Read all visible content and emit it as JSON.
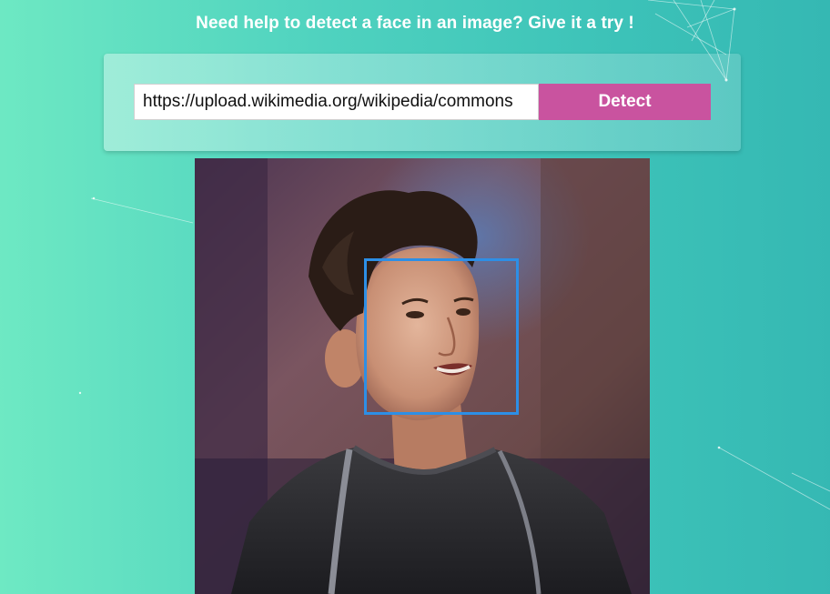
{
  "header": {
    "title": "Need help to detect a face in an image? Give it a try !"
  },
  "form": {
    "url_value": "https://upload.wikimedia.org/wikipedia/commons",
    "detect_label": "Detect"
  },
  "result": {
    "faces_detected": 1
  },
  "colors": {
    "accent_button": "#c9539f",
    "face_box": "#2d8fe6"
  }
}
